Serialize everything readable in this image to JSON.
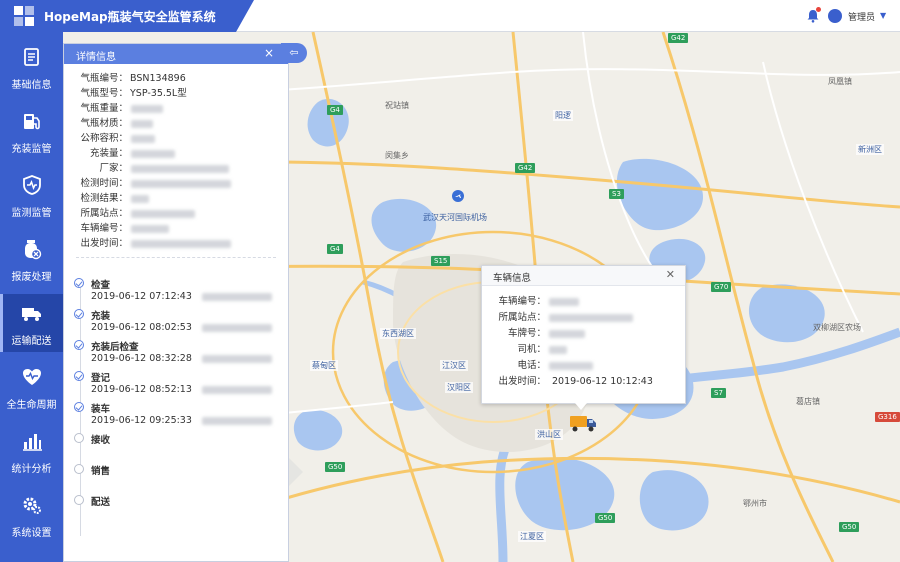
{
  "app": {
    "title": "HopeMap瓶装气安全监管系统",
    "user": "管理员"
  },
  "sidebar": {
    "items": [
      {
        "label": "基础信息",
        "icon": "document-icon"
      },
      {
        "label": "充装监管",
        "icon": "gas-pump-icon"
      },
      {
        "label": "监测监管",
        "icon": "shield-pulse-icon"
      },
      {
        "label": "报废处理",
        "icon": "cylinder-scrap-icon"
      },
      {
        "label": "运输配送",
        "icon": "truck-icon",
        "active": true
      },
      {
        "label": "全生命周期",
        "icon": "heart-pulse-icon"
      },
      {
        "label": "统计分析",
        "icon": "bar-chart-icon"
      },
      {
        "label": "系统设置",
        "icon": "gears-icon"
      }
    ]
  },
  "detail_panel": {
    "title": "详情信息",
    "fields": [
      {
        "label": "气瓶编号：",
        "value": "BSN134896"
      },
      {
        "label": "气瓶型号：",
        "value": "YSP-35.5L型"
      },
      {
        "label": "气瓶重量：",
        "value": ""
      },
      {
        "label": "气瓶材质：",
        "value": ""
      },
      {
        "label": "公称容积：",
        "value": ""
      },
      {
        "label": "充装量：",
        "value": ""
      },
      {
        "label": "厂家：",
        "value": ""
      },
      {
        "label": "检测时间：",
        "value": ""
      },
      {
        "label": "检测结果：",
        "value": ""
      },
      {
        "label": "所属站点：",
        "value": ""
      },
      {
        "label": "车辆编号：",
        "value": ""
      },
      {
        "label": "出发时间：",
        "value": ""
      }
    ],
    "timeline": [
      {
        "name": "检查",
        "time": "2019-06-12  07:12:43",
        "done": true
      },
      {
        "name": "充装",
        "time": "2019-06-12  08:02:53",
        "done": true
      },
      {
        "name": "充装后检查",
        "time": "2019-06-12  08:32:28",
        "done": true
      },
      {
        "name": "登记",
        "time": "2019-06-12  08:52:13",
        "done": true
      },
      {
        "name": "装车",
        "time": "2019-06-12  09:25:33",
        "done": true
      },
      {
        "name": "接收",
        "time": "",
        "done": false
      },
      {
        "name": "销售",
        "time": "",
        "done": false
      },
      {
        "name": "配送",
        "time": "",
        "done": false
      }
    ]
  },
  "vehicle_popup": {
    "title": "车辆信息",
    "fields": [
      {
        "label": "车辆编号：",
        "value": ""
      },
      {
        "label": "所属站点：",
        "value": ""
      },
      {
        "label": "车牌号：",
        "value": ""
      },
      {
        "label": "司机：",
        "value": ""
      },
      {
        "label": "电话：",
        "value": ""
      },
      {
        "label": "出发时间：",
        "value": "2019-06-12  10:12:43"
      }
    ]
  },
  "map": {
    "places": [
      "祝站镇",
      "阳逻",
      "闵集乡",
      "武汉天河国际机场",
      "东西湖区",
      "江汉区",
      "汉阳区",
      "蔡甸区",
      "汉南区",
      "江夏区",
      "黄陂区",
      "新洲区",
      "洪山区",
      "双柳湖区农场",
      "邾城街",
      "大湖",
      "葛店镇",
      "鄂州市",
      "凤凰镇"
    ],
    "roads": [
      "G42",
      "G4",
      "G50",
      "S15",
      "S3",
      "G70",
      "S7",
      "G316",
      "G42"
    ]
  }
}
